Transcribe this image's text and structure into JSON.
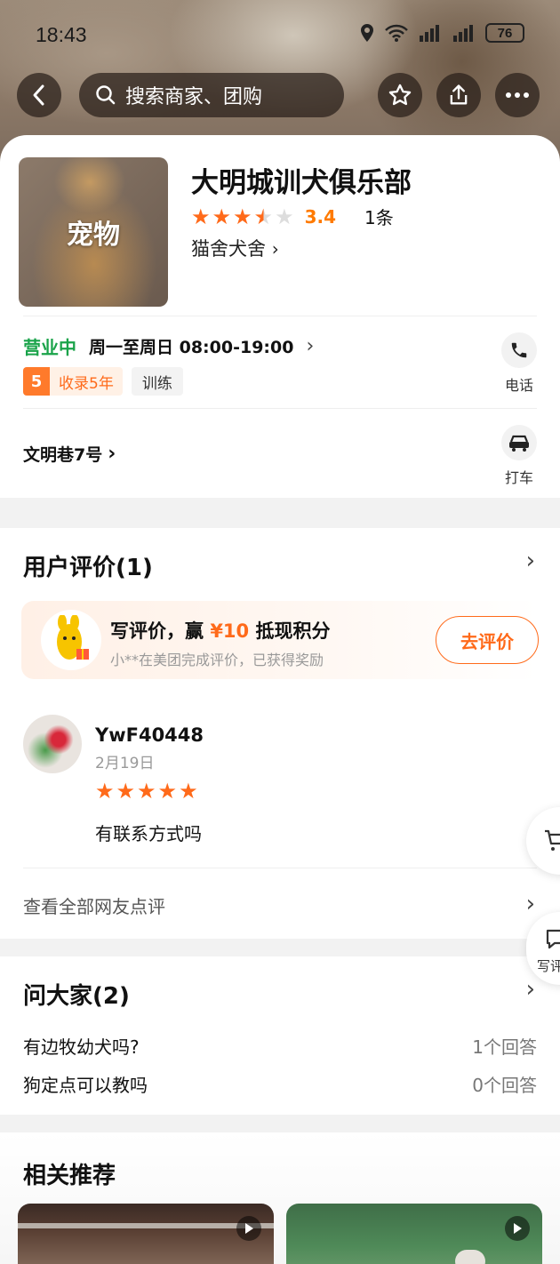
{
  "status_bar": {
    "time": "18:43",
    "battery": "76"
  },
  "top_bar": {
    "search_placeholder": "搜索商家、团购"
  },
  "shop": {
    "thumbnail_label": "宠物",
    "name": "大明城训犬俱乐部",
    "rating": 3.4,
    "rating_text": "3.4",
    "review_count": "1条",
    "category": "猫舍犬舍",
    "status": "营业中",
    "hours": "周一至周日 08:00-19:00",
    "tag_years_num": "5",
    "tag_years_label": "收录5年",
    "tag_service": "训练",
    "phone_label": "电话",
    "address": "文明巷7号",
    "taxi_label": "打车"
  },
  "reviews": {
    "title": "用户评价(1)",
    "promo_main_prefix": "写评价，赢",
    "promo_money": "¥10",
    "promo_main_suffix": "抵现积分",
    "promo_sub": "小**在美团完成评价，已获得奖励",
    "promo_button": "去评价",
    "items": [
      {
        "user": "YwF40448",
        "date": "2月19日",
        "stars": 5,
        "comment": "有联系方式吗"
      }
    ],
    "see_all": "查看全部网友点评"
  },
  "questions": {
    "title": "问大家(2)",
    "items": [
      {
        "q": "有边牧幼犬吗?",
        "answers": "1个回答"
      },
      {
        "q": "狗定点可以教吗",
        "answers": "0个回答"
      }
    ]
  },
  "floating": {
    "write_label": "写评"
  },
  "recommend": {
    "title": "相关推荐"
  },
  "colors": {
    "accent": "#ff6a1a",
    "open_green": "#1aa34a",
    "star": "#ff6a1a"
  }
}
